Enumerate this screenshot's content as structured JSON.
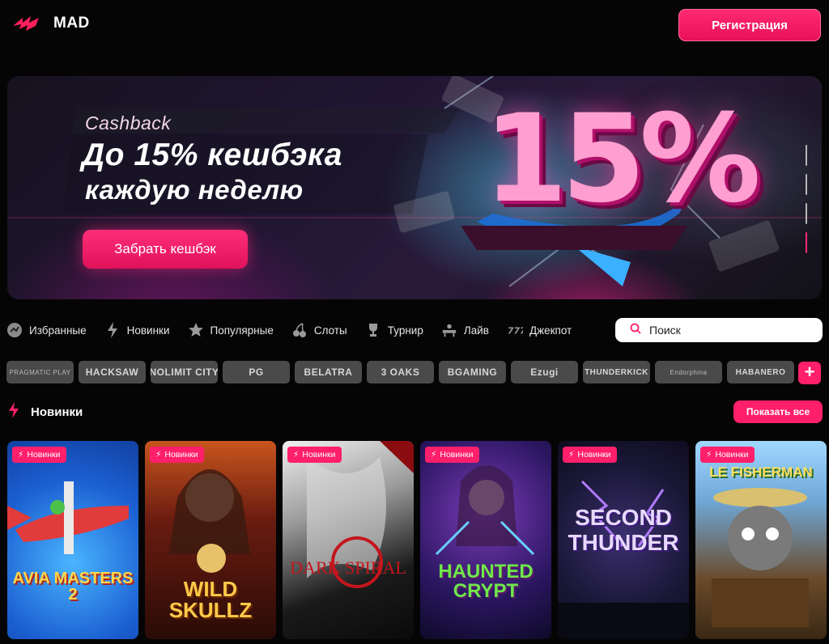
{
  "header": {
    "logo_text": "MAD",
    "register_label": "Регистрация"
  },
  "banner": {
    "tag": "Cashback",
    "line1": "До 15% кешбэка",
    "line2": "каждую неделю",
    "big_number": "15%",
    "cta_label": "Забрать кешбэк",
    "slides_count": 4,
    "active_slide": 4
  },
  "categories": [
    {
      "label": "Избранные",
      "icon": "favorites-icon"
    },
    {
      "label": "Новинки",
      "icon": "lightning-icon"
    },
    {
      "label": "Популярные",
      "icon": "star-icon"
    },
    {
      "label": "Слоты",
      "icon": "cherry-icon"
    },
    {
      "label": "Турнир",
      "icon": "trophy-icon"
    },
    {
      "label": "Лайв",
      "icon": "live-table-icon"
    },
    {
      "label": "Джекпот",
      "icon": "jackpot-777-icon"
    }
  ],
  "search": {
    "placeholder": "Поиск"
  },
  "providers": [
    "PRAGMATIC PLAY",
    "HACKSAW",
    "NOLIMIT CITY",
    "PG",
    "BELATRA",
    "3 OAKS",
    "BGAMING",
    "Ezugi",
    "THUNDERKICK",
    "Endorphina",
    "HABANERO"
  ],
  "providers_more": "+",
  "section": {
    "title": "Новинки",
    "show_all_label": "Показать все"
  },
  "games": [
    {
      "badge": "Новинки",
      "title": "AVIA MASTERS 2"
    },
    {
      "badge": "Новинки",
      "title": "WILD SKULLZ"
    },
    {
      "badge": "Новинки",
      "title": "DARK SPIRAL"
    },
    {
      "badge": "Новинки",
      "title": "HAUNTED CRYPT"
    },
    {
      "badge": "Новинки",
      "title": "SECOND THUNDER"
    },
    {
      "badge": "Новинки",
      "title": "LE FISHERMAN"
    }
  ],
  "colors": {
    "accent": "#ff1f6b",
    "background": "#050505",
    "provider_chip": "#4a4a4a"
  }
}
